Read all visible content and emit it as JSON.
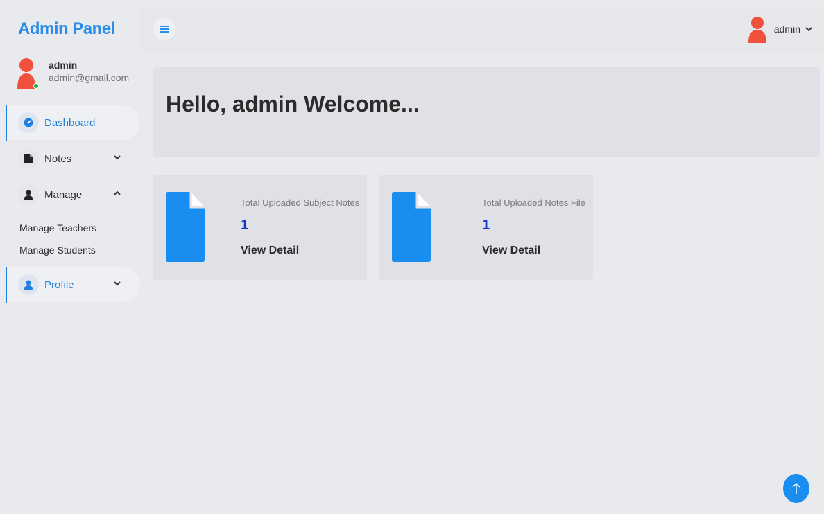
{
  "sidebar": {
    "brand": "Admin Panel",
    "user": {
      "name": "admin",
      "email": "admin@gmail.com"
    },
    "items": [
      {
        "label": "Dashboard",
        "icon": "dashboard-icon"
      },
      {
        "label": "Notes",
        "icon": "file-icon"
      },
      {
        "label": "Manage",
        "icon": "user-icon"
      },
      {
        "label": "Profile",
        "icon": "user-icon"
      }
    ],
    "manage_submenu": [
      "Manage Teachers",
      "Manage Students"
    ]
  },
  "topbar": {
    "menu_icon": "hamburger-icon",
    "user_label": "admin"
  },
  "welcome": {
    "title": "Hello, admin Welcome..."
  },
  "cards": [
    {
      "label": "Total Uploaded Subject Notes",
      "count": "1",
      "link": "View Detail"
    },
    {
      "label": "Total Uploaded Notes File",
      "count": "1",
      "link": "View Detail"
    }
  ],
  "colors": {
    "accent": "#2a8ee8",
    "avatar": "#f0503c",
    "count": "#1532c9",
    "doc": "#1a8ef0"
  }
}
